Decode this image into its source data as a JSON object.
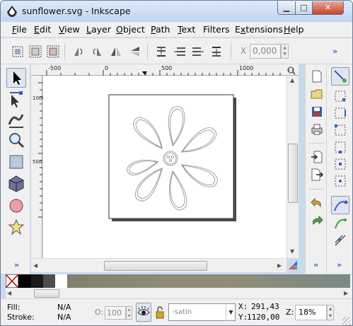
{
  "window": {
    "title": "sunflower.svg - Inkscape",
    "min_label": "▁",
    "max_label": "□",
    "close_label": "✕"
  },
  "menu": [
    {
      "label": "File",
      "accel": "F",
      "rest": "ile"
    },
    {
      "label": "Edit",
      "accel": "E",
      "rest": "dit"
    },
    {
      "label": "View",
      "accel": "V",
      "rest": "iew"
    },
    {
      "label": "Layer",
      "accel": "L",
      "rest": "ayer"
    },
    {
      "label": "Object",
      "accel": "O",
      "rest": "bject"
    },
    {
      "label": "Path",
      "accel": "P",
      "rest": "ath"
    },
    {
      "label": "Text",
      "accel": "T",
      "rest": "ext"
    },
    {
      "label": "Filters",
      "accel": "",
      "rest": "Filters"
    },
    {
      "label": "Extensions",
      "accel": "x",
      "pre": "E",
      "rest": "tensions"
    },
    {
      "label": "Help",
      "accel": "H",
      "rest": "elp"
    }
  ],
  "toolbar": {
    "x_label": "X",
    "x_value": "0,000",
    "overflow": "»"
  },
  "ruler": {
    "top_labels": [
      "-500",
      "0",
      "500",
      "1000"
    ],
    "left_labels": [
      "1000",
      "500"
    ]
  },
  "toolbox_overflow": "»",
  "snap_overflow": "»",
  "status": {
    "fill_label": "Fill:",
    "fill_value": "N/A",
    "stroke_label": "Stroke:",
    "stroke_value": "N/A",
    "opacity_label": "O:",
    "opacity_value": "100",
    "layer_value": "-satin",
    "x_label": "X:",
    "x_value": "291,43",
    "y_label": "Y:",
    "y_value": "1120,00",
    "zoom_label": "Z:",
    "zoom_value": "18%"
  },
  "palette": {
    "colors": [
      "#000000",
      "#1a1a1a",
      "#4d4d4d",
      "#ffffff",
      "#808070",
      "#8d8b78",
      "#908c7a",
      "#8a8a7a",
      "#7f8b80",
      "#7b8a86"
    ]
  },
  "colors": {
    "accent": "#3b5dbf",
    "window_frame": "#c9d9ee"
  }
}
